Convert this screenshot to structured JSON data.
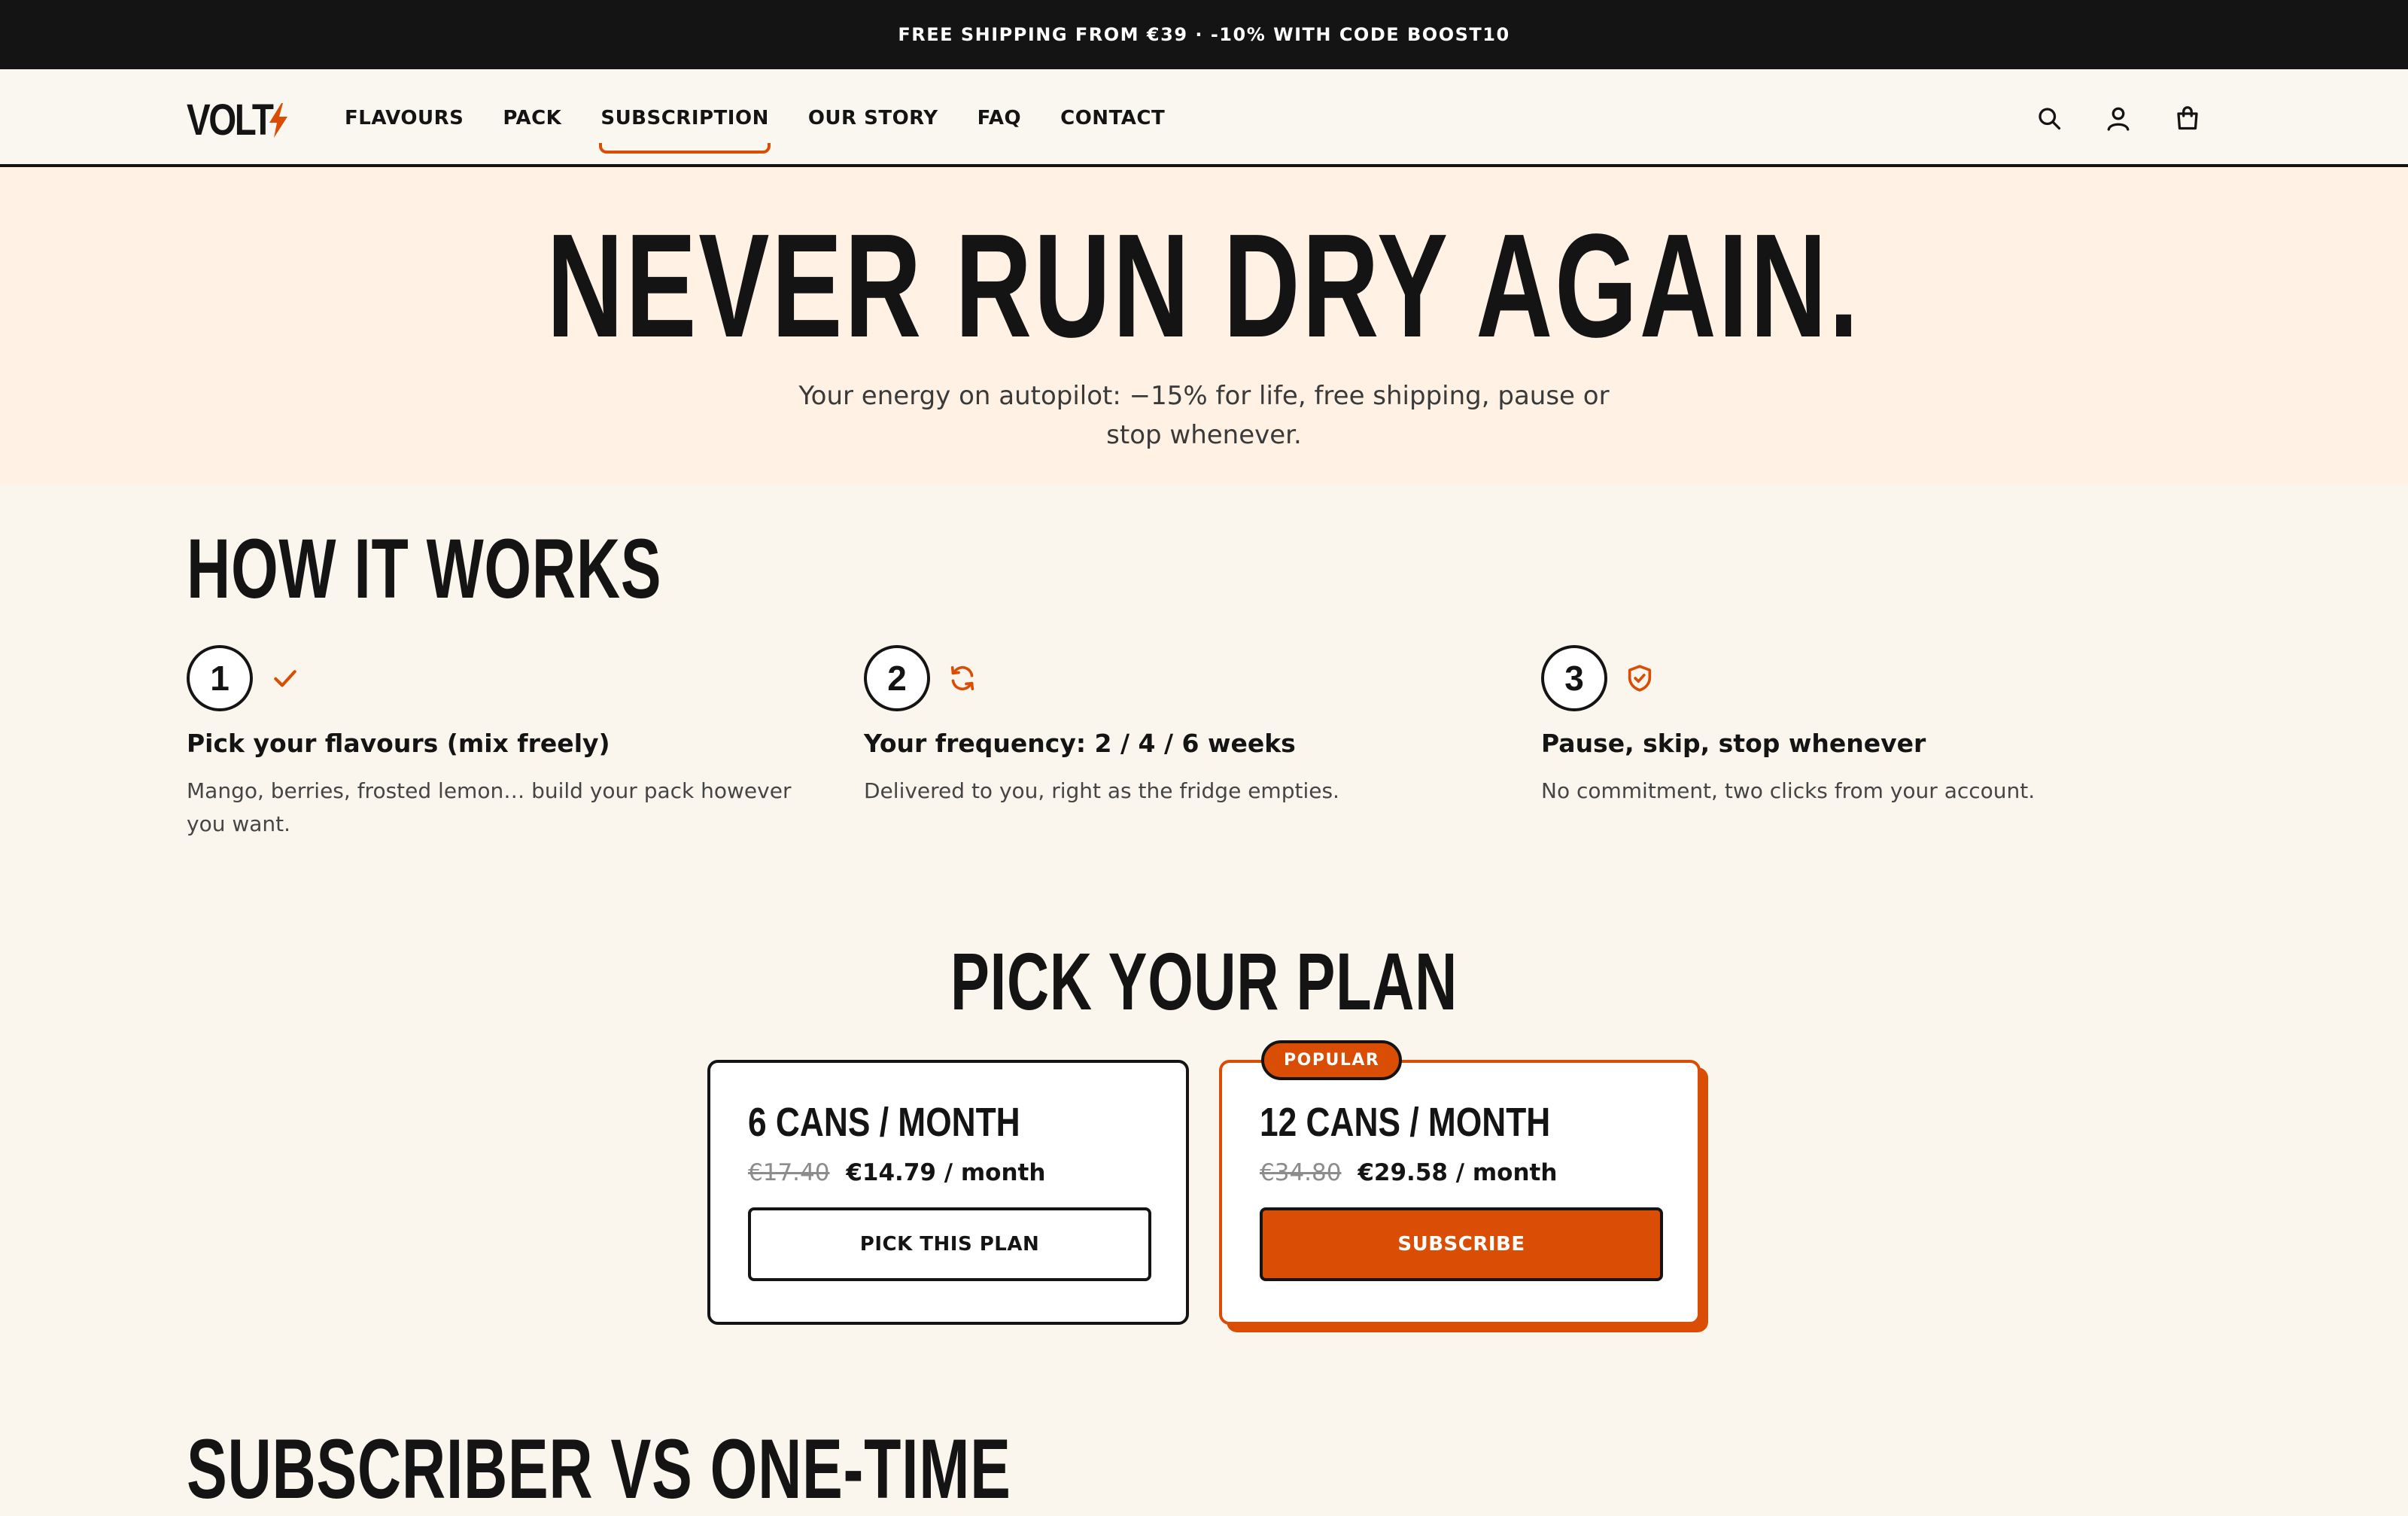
{
  "announcement": "FREE SHIPPING FROM €39 · -10% WITH CODE BOOST10",
  "header": {
    "logo": "VOLT",
    "nav": [
      "FLAVOURS",
      "PACK",
      "SUBSCRIPTION",
      "OUR STORY",
      "FAQ",
      "CONTACT"
    ],
    "active_nav": "SUBSCRIPTION",
    "icons": [
      "search-icon",
      "account-icon",
      "cart-icon"
    ]
  },
  "hero": {
    "title": "NEVER RUN DRY AGAIN.",
    "subtitle": "Your energy on autopilot: −15% for life, free shipping, pause or stop whenever."
  },
  "how": {
    "title": "HOW IT WORKS",
    "steps": [
      {
        "num": "1",
        "icon": "check-icon",
        "title": "Pick your flavours (mix freely)",
        "desc": "Mango, berries, frosted lemon… build your pack however you want."
      },
      {
        "num": "2",
        "icon": "refresh-icon",
        "title": "Your frequency: 2 / 4 / 6 weeks",
        "desc": "Delivered to you, right as the fridge empties."
      },
      {
        "num": "3",
        "icon": "shield-check-icon",
        "title": "Pause, skip, stop whenever",
        "desc": "No commitment, two clicks from your account."
      }
    ]
  },
  "plans": {
    "title": "PICK YOUR PLAN",
    "items": [
      {
        "title": "6 CANS / MONTH",
        "old_price": "€17.40",
        "new_price": "€14.79 / month",
        "button": "PICK THIS PLAN"
      },
      {
        "badge": "POPULAR",
        "title": "12 CANS / MONTH",
        "old_price": "€34.80",
        "new_price": "€29.58 / month",
        "button": "SUBSCRIBE"
      }
    ]
  },
  "compare": {
    "title": "SUBSCRIBER VS ONE-TIME"
  },
  "colors": {
    "accent": "#d94e04",
    "ink": "#141414",
    "hero_bg": "#fff1e3",
    "page_bg": "#faf6ee"
  }
}
